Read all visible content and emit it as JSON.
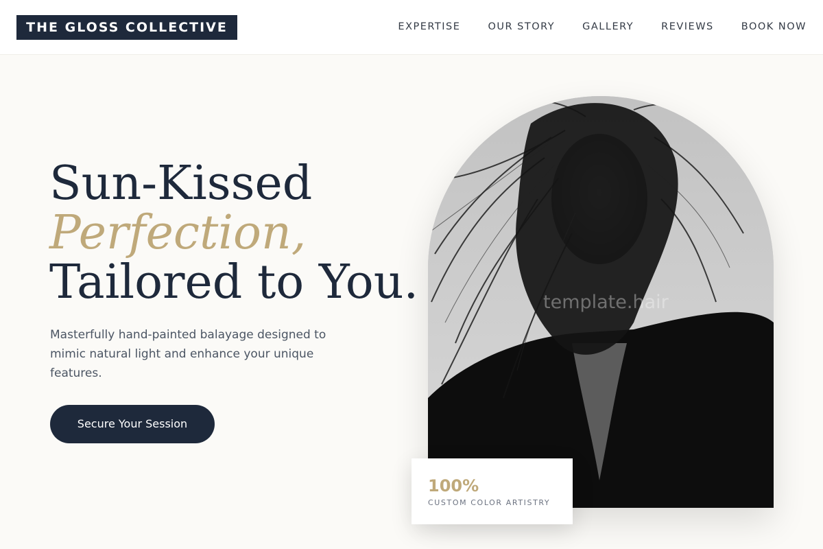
{
  "header": {
    "brand": "THE GLOSS COLLECTIVE",
    "nav": [
      "EXPERTISE",
      "OUR STORY",
      "GALLERY",
      "REVIEWS",
      "BOOK NOW"
    ]
  },
  "hero": {
    "title_line1": "Sun-Kissed",
    "title_line2": "Perfection,",
    "title_line3": "Tailored to You.",
    "subtitle": "Masterfully hand-painted balayage designed to mimic natural light and enhance your unique features.",
    "cta_label": "Secure Your Session"
  },
  "photo": {
    "watermark": "template.hair"
  },
  "stat": {
    "value": "100%",
    "label": "CUSTOM COLOR ARTISTRY"
  },
  "colors": {
    "navy": "#1e293b",
    "gold": "#bfa97a",
    "background": "#fbfaf7"
  }
}
